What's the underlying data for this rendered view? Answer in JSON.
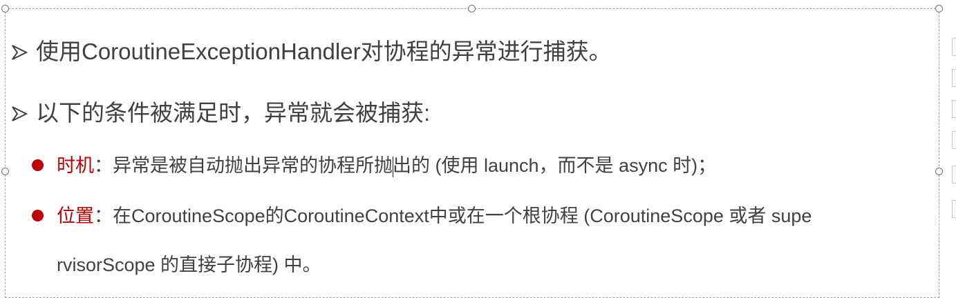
{
  "slide": {
    "bullets": [
      {
        "text": "使用CoroutineExceptionHandler对协程的异常进行捕获。"
      },
      {
        "text": "以下的条件被满足时，异常就会被捕获:",
        "sub_bullets": [
          {
            "term": "时机",
            "separator": "：",
            "text_before_caret": "异常是被自动抛出异常的协程所抛",
            "text_after_caret": "出的 (使用 launch，而不是 async 时)；"
          },
          {
            "term": "位置",
            "separator": "：",
            "text": "在CoroutineScope的CoroutineContext中或在一个根协程 (CoroutineScope 或者 supe",
            "continuation": "rvisorScope 的直接子协程) 中。"
          }
        ]
      }
    ]
  },
  "colors": {
    "body_text": "#404040",
    "accent_red": "#c00000",
    "selection_frame": "#a0a0a0"
  },
  "icons": {
    "level1_bullet": "arrowhead-bullet-icon",
    "level2_bullet": "red-dot-bullet-icon",
    "resize_handle": "resize-handle-icon"
  }
}
